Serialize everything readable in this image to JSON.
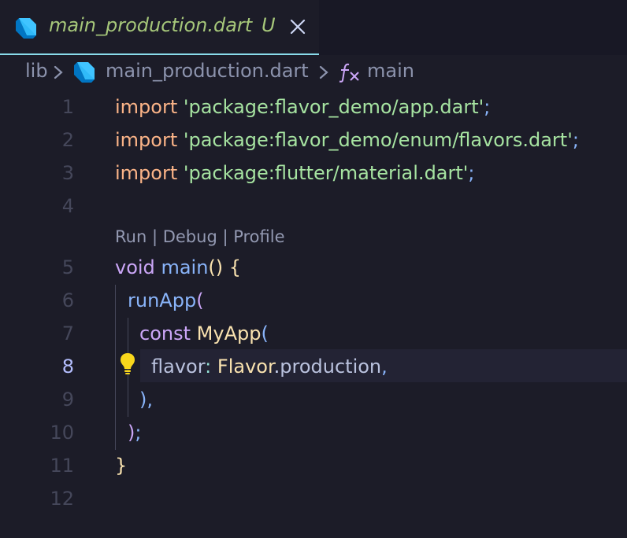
{
  "tab": {
    "title": "main_production.dart",
    "badge": "U"
  },
  "breadcrumb": {
    "folder": "lib",
    "file": "main_production.dart",
    "symbol": "main"
  },
  "line_numbers": [
    "1",
    "2",
    "3",
    "4",
    "5",
    "6",
    "7",
    "8",
    "9",
    "10",
    "11",
    "12"
  ],
  "codelens": {
    "run": "Run",
    "sep1": " | ",
    "debug": "Debug",
    "sep2": " | ",
    "profile": "Profile"
  },
  "code": {
    "l1": {
      "kw": "import",
      "str": "'package:flavor_demo/app.dart'",
      "end": ";"
    },
    "l2": {
      "kw": "import",
      "str": "'package:flavor_demo/enum/flavors.dart'",
      "end": ";"
    },
    "l3": {
      "kw": "import",
      "str": "'package:flutter/material.dart'",
      "end": ";"
    },
    "l5": {
      "kw": "void",
      "fn": "main",
      "parens": "()",
      "brace": "{"
    },
    "l6": {
      "fn": "runApp",
      "paren": "("
    },
    "l7": {
      "kw": "const",
      "cls": "MyApp",
      "paren": "("
    },
    "l8": {
      "prop": "flavor",
      "colon": ":",
      "cls": "Flavor",
      "dot": ".",
      "member": "production",
      "comma": ","
    },
    "l9": {
      "paren": ")",
      "comma": ","
    },
    "l10": {
      "paren": ")",
      "end": ";"
    },
    "l11": {
      "brace": "}"
    }
  },
  "colors": {
    "background": "#1c1c28",
    "tab_accent": "#89dceb",
    "modified_text": "#a6c77a",
    "keyword_import": "#fab387",
    "string": "#a6e3a1",
    "keyword": "#cba6f7",
    "function": "#89b4fa",
    "class": "#f9e2af"
  },
  "icons": {
    "tab_file": "dart-file-icon",
    "tab_close": "close-icon",
    "breadcrumb_sep": "chevron-right-icon",
    "breadcrumb_file": "dart-file-icon",
    "breadcrumb_symbol": "function-icon",
    "lightbulb": "lightbulb-icon"
  }
}
